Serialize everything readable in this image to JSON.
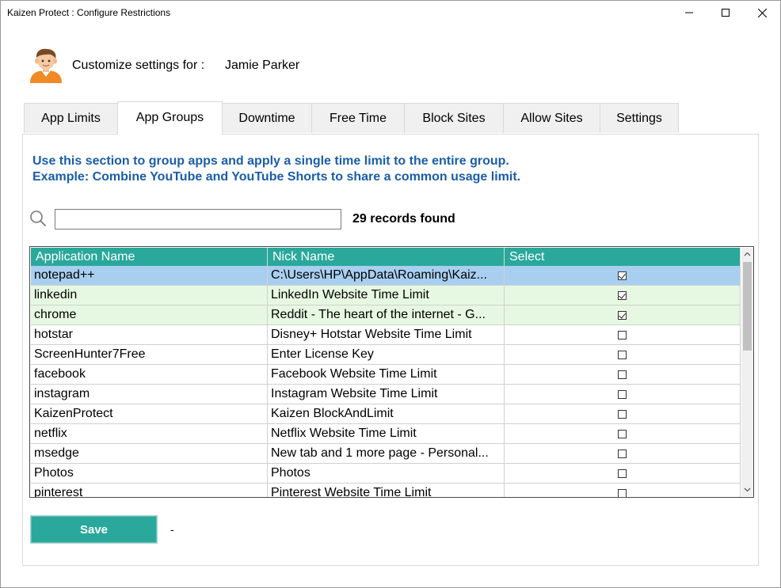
{
  "window": {
    "title": "Kaizen Protect : Configure Restrictions",
    "controls": [
      "minimize-icon",
      "maximize-icon",
      "close-icon"
    ]
  },
  "header": {
    "customize_label": "Customize settings for :",
    "user_name": "Jamie Parker",
    "avatar_icon": "user-avatar-icon"
  },
  "tabs": [
    {
      "label": "App Limits",
      "active": false
    },
    {
      "label": "App Groups",
      "active": true
    },
    {
      "label": "Downtime",
      "active": false
    },
    {
      "label": "Free Time",
      "active": false
    },
    {
      "label": "Block Sites",
      "active": false
    },
    {
      "label": "Allow Sites",
      "active": false
    },
    {
      "label": "Settings",
      "active": false
    }
  ],
  "info": {
    "line1": "Use this section to group apps and apply a single time limit to the entire group.",
    "line2": "Example: Combine YouTube and YouTube Shorts to share a common usage limit."
  },
  "search": {
    "value": "",
    "placeholder": "",
    "icon": "search-icon",
    "records_text": "29 records found"
  },
  "grid": {
    "columns": [
      "Application Name",
      "Nick Name",
      "Select"
    ],
    "rows": [
      {
        "app": "notepad++",
        "nick": "C:\\Users\\HP\\AppData\\Roaming\\Kaiz...",
        "selected": true,
        "state": "current"
      },
      {
        "app": "linkedin",
        "nick": "LinkedIn Website Time Limit",
        "selected": true,
        "state": "checked"
      },
      {
        "app": "chrome",
        "nick": "Reddit - The heart of the internet - G...",
        "selected": true,
        "state": "checked"
      },
      {
        "app": "hotstar",
        "nick": "Disney+ Hotstar Website Time Limit",
        "selected": false,
        "state": "normal"
      },
      {
        "app": "ScreenHunter7Free",
        "nick": "Enter License Key",
        "selected": false,
        "state": "normal"
      },
      {
        "app": "facebook",
        "nick": "Facebook Website Time Limit",
        "selected": false,
        "state": "normal"
      },
      {
        "app": "instagram",
        "nick": "Instagram Website Time Limit",
        "selected": false,
        "state": "normal"
      },
      {
        "app": "KaizenProtect",
        "nick": "Kaizen BlockAndLimit",
        "selected": false,
        "state": "normal"
      },
      {
        "app": "netflix",
        "nick": "Netflix Website Time Limit",
        "selected": false,
        "state": "normal"
      },
      {
        "app": "msedge",
        "nick": "New tab and 1 more page - Personal...",
        "selected": false,
        "state": "normal"
      },
      {
        "app": "Photos",
        "nick": "Photos",
        "selected": false,
        "state": "normal"
      },
      {
        "app": "pinterest",
        "nick": "Pinterest Website Time Limit",
        "selected": false,
        "state": "normal"
      }
    ]
  },
  "footer": {
    "save_label": "Save",
    "status_text": "-"
  },
  "colors": {
    "header_teal": "#2aa89b",
    "current_row": "#a9cff0",
    "checked_row": "#e6f8e1",
    "info_text": "#1a5ea8"
  }
}
